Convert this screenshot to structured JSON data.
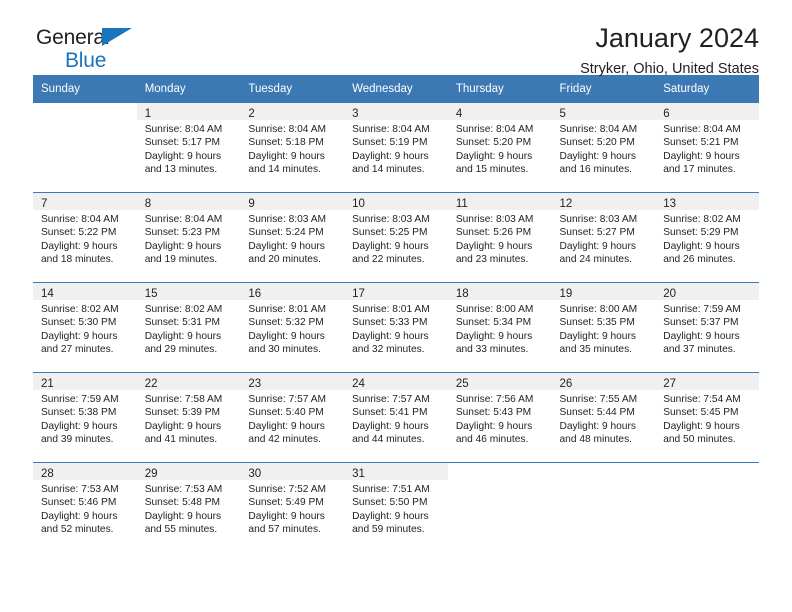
{
  "brand": {
    "name_line1": "General",
    "name_line2": "Blue",
    "triangle_color": "#1b75bc"
  },
  "header": {
    "title": "January 2024",
    "subtitle": "Stryker, Ohio, United States"
  },
  "theme": {
    "header_blue": "#3c78b4",
    "daynum_band": "#f0f0f0",
    "text": "#231f20"
  },
  "weekday_headers": [
    "Sunday",
    "Monday",
    "Tuesday",
    "Wednesday",
    "Thursday",
    "Friday",
    "Saturday"
  ],
  "labels": {
    "sunrise_prefix": "Sunrise:",
    "sunset_prefix": "Sunset:",
    "daylight_prefix": "Daylight:"
  },
  "weeks": [
    [
      {
        "day": "",
        "empty": true
      },
      {
        "day": "1",
        "sunrise": "Sunrise: 8:04 AM",
        "sunset": "Sunset: 5:17 PM",
        "daylight_l1": "Daylight: 9 hours",
        "daylight_l2": "and 13 minutes."
      },
      {
        "day": "2",
        "sunrise": "Sunrise: 8:04 AM",
        "sunset": "Sunset: 5:18 PM",
        "daylight_l1": "Daylight: 9 hours",
        "daylight_l2": "and 14 minutes."
      },
      {
        "day": "3",
        "sunrise": "Sunrise: 8:04 AM",
        "sunset": "Sunset: 5:19 PM",
        "daylight_l1": "Daylight: 9 hours",
        "daylight_l2": "and 14 minutes."
      },
      {
        "day": "4",
        "sunrise": "Sunrise: 8:04 AM",
        "sunset": "Sunset: 5:20 PM",
        "daylight_l1": "Daylight: 9 hours",
        "daylight_l2": "and 15 minutes."
      },
      {
        "day": "5",
        "sunrise": "Sunrise: 8:04 AM",
        "sunset": "Sunset: 5:20 PM",
        "daylight_l1": "Daylight: 9 hours",
        "daylight_l2": "and 16 minutes."
      },
      {
        "day": "6",
        "sunrise": "Sunrise: 8:04 AM",
        "sunset": "Sunset: 5:21 PM",
        "daylight_l1": "Daylight: 9 hours",
        "daylight_l2": "and 17 minutes."
      }
    ],
    [
      {
        "day": "7",
        "sunrise": "Sunrise: 8:04 AM",
        "sunset": "Sunset: 5:22 PM",
        "daylight_l1": "Daylight: 9 hours",
        "daylight_l2": "and 18 minutes."
      },
      {
        "day": "8",
        "sunrise": "Sunrise: 8:04 AM",
        "sunset": "Sunset: 5:23 PM",
        "daylight_l1": "Daylight: 9 hours",
        "daylight_l2": "and 19 minutes."
      },
      {
        "day": "9",
        "sunrise": "Sunrise: 8:03 AM",
        "sunset": "Sunset: 5:24 PM",
        "daylight_l1": "Daylight: 9 hours",
        "daylight_l2": "and 20 minutes."
      },
      {
        "day": "10",
        "sunrise": "Sunrise: 8:03 AM",
        "sunset": "Sunset: 5:25 PM",
        "daylight_l1": "Daylight: 9 hours",
        "daylight_l2": "and 22 minutes."
      },
      {
        "day": "11",
        "sunrise": "Sunrise: 8:03 AM",
        "sunset": "Sunset: 5:26 PM",
        "daylight_l1": "Daylight: 9 hours",
        "daylight_l2": "and 23 minutes."
      },
      {
        "day": "12",
        "sunrise": "Sunrise: 8:03 AM",
        "sunset": "Sunset: 5:27 PM",
        "daylight_l1": "Daylight: 9 hours",
        "daylight_l2": "and 24 minutes."
      },
      {
        "day": "13",
        "sunrise": "Sunrise: 8:02 AM",
        "sunset": "Sunset: 5:29 PM",
        "daylight_l1": "Daylight: 9 hours",
        "daylight_l2": "and 26 minutes."
      }
    ],
    [
      {
        "day": "14",
        "sunrise": "Sunrise: 8:02 AM",
        "sunset": "Sunset: 5:30 PM",
        "daylight_l1": "Daylight: 9 hours",
        "daylight_l2": "and 27 minutes."
      },
      {
        "day": "15",
        "sunrise": "Sunrise: 8:02 AM",
        "sunset": "Sunset: 5:31 PM",
        "daylight_l1": "Daylight: 9 hours",
        "daylight_l2": "and 29 minutes."
      },
      {
        "day": "16",
        "sunrise": "Sunrise: 8:01 AM",
        "sunset": "Sunset: 5:32 PM",
        "daylight_l1": "Daylight: 9 hours",
        "daylight_l2": "and 30 minutes."
      },
      {
        "day": "17",
        "sunrise": "Sunrise: 8:01 AM",
        "sunset": "Sunset: 5:33 PM",
        "daylight_l1": "Daylight: 9 hours",
        "daylight_l2": "and 32 minutes."
      },
      {
        "day": "18",
        "sunrise": "Sunrise: 8:00 AM",
        "sunset": "Sunset: 5:34 PM",
        "daylight_l1": "Daylight: 9 hours",
        "daylight_l2": "and 33 minutes."
      },
      {
        "day": "19",
        "sunrise": "Sunrise: 8:00 AM",
        "sunset": "Sunset: 5:35 PM",
        "daylight_l1": "Daylight: 9 hours",
        "daylight_l2": "and 35 minutes."
      },
      {
        "day": "20",
        "sunrise": "Sunrise: 7:59 AM",
        "sunset": "Sunset: 5:37 PM",
        "daylight_l1": "Daylight: 9 hours",
        "daylight_l2": "and 37 minutes."
      }
    ],
    [
      {
        "day": "21",
        "sunrise": "Sunrise: 7:59 AM",
        "sunset": "Sunset: 5:38 PM",
        "daylight_l1": "Daylight: 9 hours",
        "daylight_l2": "and 39 minutes."
      },
      {
        "day": "22",
        "sunrise": "Sunrise: 7:58 AM",
        "sunset": "Sunset: 5:39 PM",
        "daylight_l1": "Daylight: 9 hours",
        "daylight_l2": "and 41 minutes."
      },
      {
        "day": "23",
        "sunrise": "Sunrise: 7:57 AM",
        "sunset": "Sunset: 5:40 PM",
        "daylight_l1": "Daylight: 9 hours",
        "daylight_l2": "and 42 minutes."
      },
      {
        "day": "24",
        "sunrise": "Sunrise: 7:57 AM",
        "sunset": "Sunset: 5:41 PM",
        "daylight_l1": "Daylight: 9 hours",
        "daylight_l2": "and 44 minutes."
      },
      {
        "day": "25",
        "sunrise": "Sunrise: 7:56 AM",
        "sunset": "Sunset: 5:43 PM",
        "daylight_l1": "Daylight: 9 hours",
        "daylight_l2": "and 46 minutes."
      },
      {
        "day": "26",
        "sunrise": "Sunrise: 7:55 AM",
        "sunset": "Sunset: 5:44 PM",
        "daylight_l1": "Daylight: 9 hours",
        "daylight_l2": "and 48 minutes."
      },
      {
        "day": "27",
        "sunrise": "Sunrise: 7:54 AM",
        "sunset": "Sunset: 5:45 PM",
        "daylight_l1": "Daylight: 9 hours",
        "daylight_l2": "and 50 minutes."
      }
    ],
    [
      {
        "day": "28",
        "sunrise": "Sunrise: 7:53 AM",
        "sunset": "Sunset: 5:46 PM",
        "daylight_l1": "Daylight: 9 hours",
        "daylight_l2": "and 52 minutes."
      },
      {
        "day": "29",
        "sunrise": "Sunrise: 7:53 AM",
        "sunset": "Sunset: 5:48 PM",
        "daylight_l1": "Daylight: 9 hours",
        "daylight_l2": "and 55 minutes."
      },
      {
        "day": "30",
        "sunrise": "Sunrise: 7:52 AM",
        "sunset": "Sunset: 5:49 PM",
        "daylight_l1": "Daylight: 9 hours",
        "daylight_l2": "and 57 minutes."
      },
      {
        "day": "31",
        "sunrise": "Sunrise: 7:51 AM",
        "sunset": "Sunset: 5:50 PM",
        "daylight_l1": "Daylight: 9 hours",
        "daylight_l2": "and 59 minutes."
      },
      {
        "day": "",
        "empty": true
      },
      {
        "day": "",
        "empty": true
      },
      {
        "day": "",
        "empty": true
      }
    ]
  ]
}
